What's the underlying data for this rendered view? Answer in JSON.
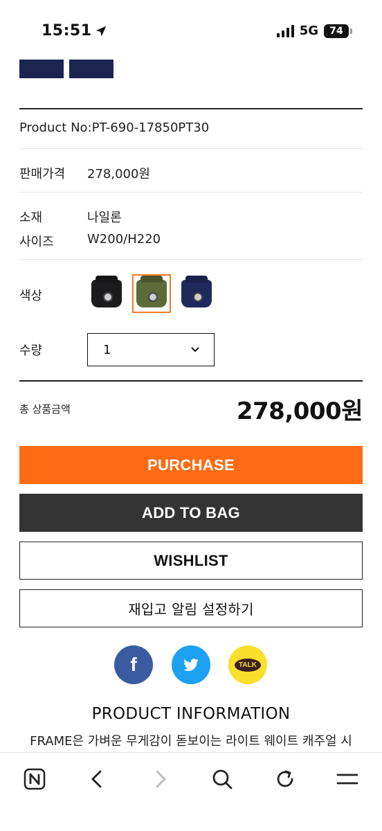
{
  "status_bar": {
    "time": "15:51",
    "network": "5G",
    "battery": "74"
  },
  "product": {
    "number": "Product No:PT-690-17850PT30",
    "price_label": "판매가격",
    "price_value": "278,000원",
    "material_label": "소재",
    "material_value": "나일론",
    "size_label": "사이즈",
    "size_value": "W200/H220",
    "color_label": "색상",
    "colors": [
      {
        "name": "black",
        "hex": "#1c1c1f",
        "selected": false
      },
      {
        "name": "olive",
        "hex": "#5f6a3a",
        "selected": true
      },
      {
        "name": "navy",
        "hex": "#1f2a5c",
        "selected": false
      }
    ],
    "quantity_label": "수량",
    "quantity_value": "1"
  },
  "total": {
    "label": "총 상품금액",
    "value": "278,000원"
  },
  "buttons": {
    "purchase": "PURCHASE",
    "add_to_bag": "ADD TO BAG",
    "wishlist": "WISHLIST",
    "restock_alert": "재입고 알림 설정하기"
  },
  "social": {
    "facebook": "f",
    "kakao": "TALK"
  },
  "info": {
    "title": "PRODUCT INFORMATION",
    "text": "FRAME은 가벼운 무게감이 돋보이는 라이트 웨이트 캐주얼 시"
  },
  "colors": {
    "accent": "#ff6b13",
    "dark_button": "#333333",
    "facebook": "#3a5ba0",
    "twitter": "#1da1f2",
    "kakao": "#fadf2c"
  }
}
